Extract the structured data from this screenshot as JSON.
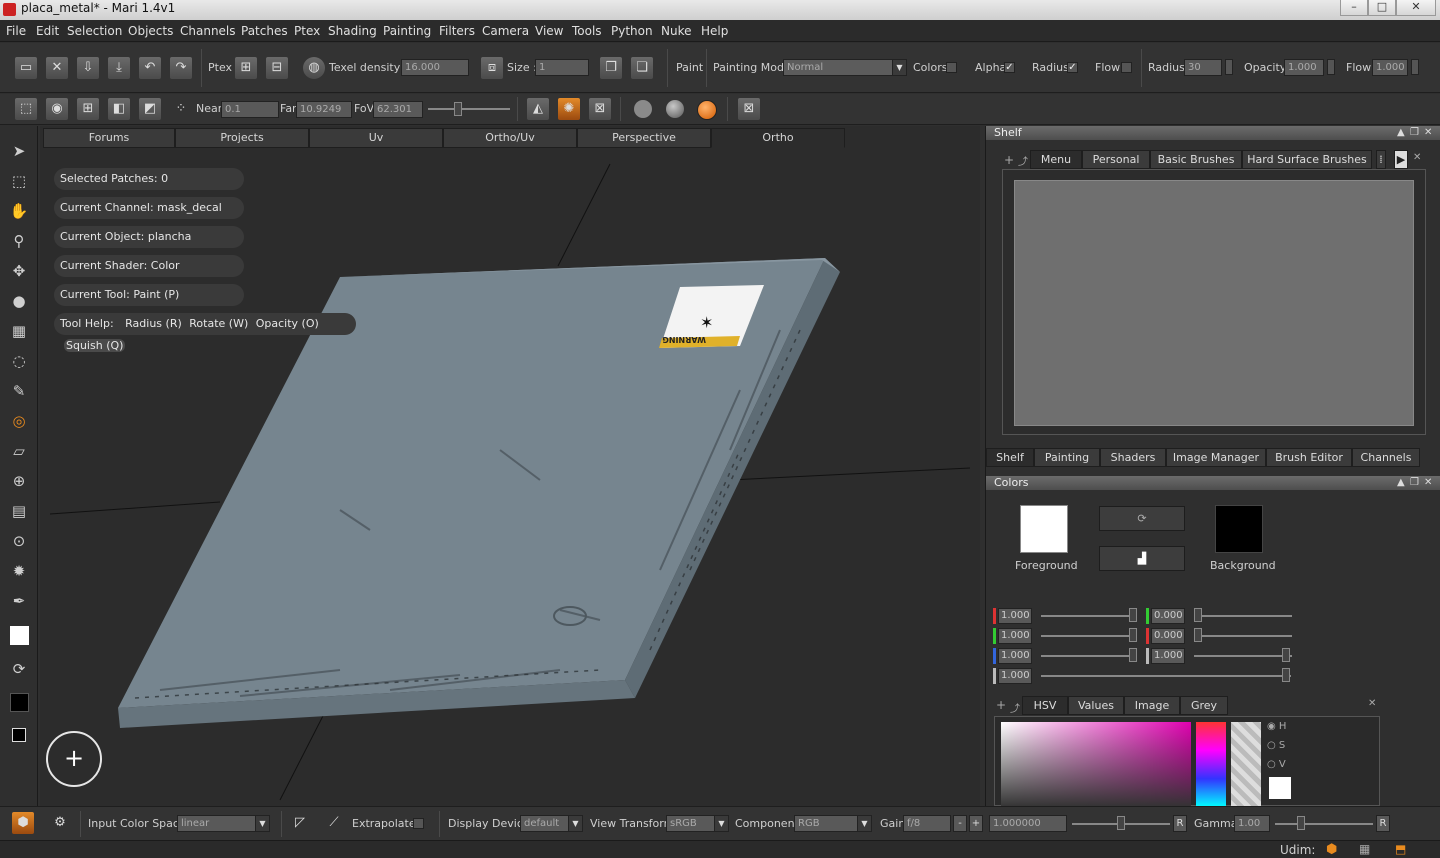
{
  "window": {
    "title": "placa_metal* - Mari 1.4v1"
  },
  "menu": [
    "File",
    "Edit",
    "Selection",
    "Objects",
    "Channels",
    "Patches",
    "Ptex",
    "Shading",
    "Painting",
    "Filters",
    "Camera",
    "View",
    "Tools",
    "Python",
    "Nuke",
    "Help"
  ],
  "toolbar1": {
    "ptex_label": "Ptex",
    "texel_label": "Texel density :",
    "texel_value": "16.000",
    "size_label": "Size :",
    "size_value": "1",
    "paint_label": "Paint",
    "painting_mode_label": "Painting Mode",
    "painting_mode_value": "Normal",
    "colors_label": "Colors",
    "alpha_label": "Alpha",
    "radius_chk_label": "Radius",
    "flow_chk_label": "Flow",
    "radius_label": "Radius",
    "radius_value": "30",
    "opacity_label": "Opacity",
    "opacity_value": "1.000",
    "flow_label": "Flow",
    "flow_value": "1.000"
  },
  "toolbar2": {
    "near_label": "Near",
    "near_value": "0.1",
    "far_label": "Far",
    "far_value": "10.9249",
    "fov_label": "FoV",
    "fov_value": "62.301"
  },
  "view_tabs": [
    "Forums",
    "Projects",
    "Uv",
    "Ortho/Uv",
    "Perspective",
    "Ortho"
  ],
  "hud": {
    "selected_patches": "Selected Patches: 0",
    "current_channel": "Current Channel: mask_decal",
    "current_object": "Current Object: plancha",
    "current_shader": "Current Shader: Color",
    "current_tool": "Current Tool: Paint (P)",
    "tool_help": "Tool Help:",
    "help_items": [
      "Radius (R)",
      "Rotate (W)",
      "Opacity (O)",
      "Squish (Q)"
    ]
  },
  "decal_text": "WARNING",
  "shelf": {
    "title": "Shelf",
    "tabs": [
      "Menu",
      "Personal",
      "Basic Brushes",
      "Hard Surface Brushes"
    ],
    "bottom_tabs": [
      "Shelf",
      "Painting",
      "Shaders",
      "Image Manager",
      "Brush Editor",
      "Channels"
    ]
  },
  "colors": {
    "title": "Colors",
    "foreground_label": "Foreground",
    "background_label": "Background",
    "foreground_color": "#ffffff",
    "background_color": "#000000",
    "fg_values": [
      "1.000",
      "1.000",
      "1.000",
      "1.000"
    ],
    "bg_values": [
      "0.000",
      "0.000",
      "1.000"
    ],
    "picker_tabs": [
      "HSV",
      "Values",
      "Image",
      "Grey"
    ],
    "hsv_options": [
      "H",
      "S",
      "V"
    ]
  },
  "statusbar": {
    "input_cs_label": "Input Color Space",
    "input_cs_value": "linear",
    "extrapolate_label": "Extrapolate",
    "display_device_label": "Display Device",
    "display_device_value": "default",
    "view_transform_label": "View Transform",
    "view_transform_value": "sRGB",
    "component_label": "Component",
    "component_value": "RGB",
    "gain_label": "Gain",
    "gain_value": "f/8",
    "gain_minus": "-",
    "gain_plus": "+",
    "gain_number": "1.000000",
    "reset_label": "R",
    "gamma_label": "Gamma",
    "gamma_value": "1.00",
    "gamma_reset": "R"
  },
  "bottombar": {
    "udim_label": "Udim:"
  }
}
